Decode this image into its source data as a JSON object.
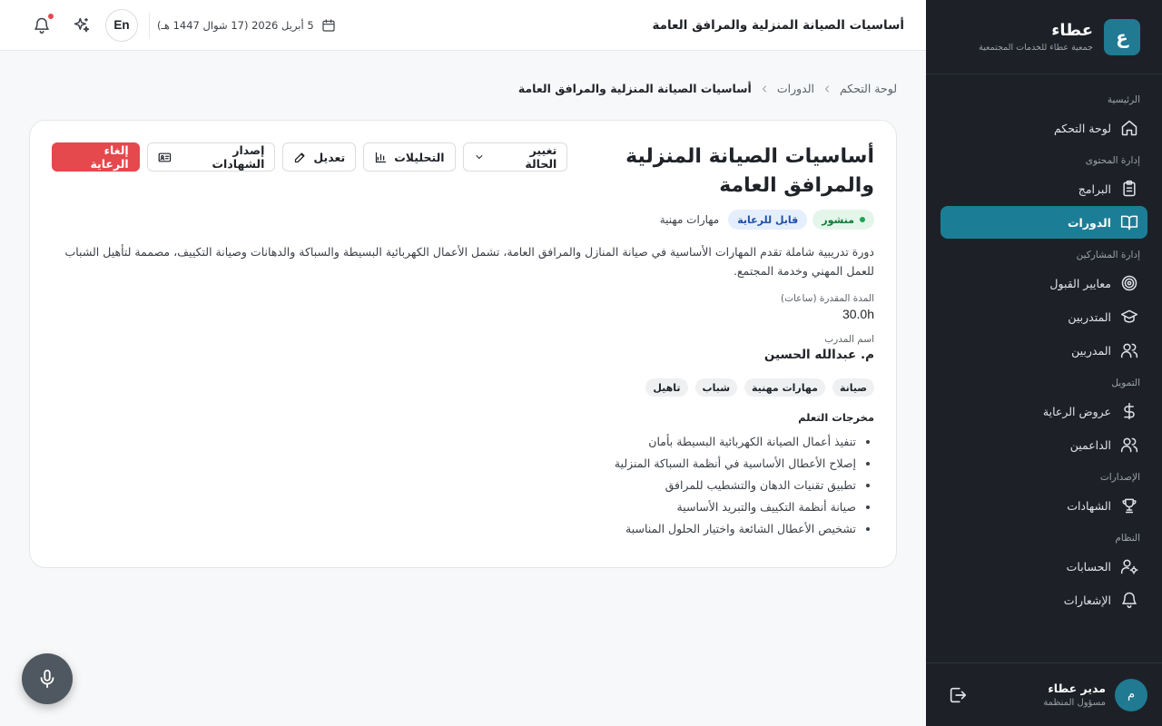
{
  "brand": {
    "logo_letter": "ع",
    "name": "عطاء",
    "subtitle": "جمعية عطاء للخدمات المجتمعية"
  },
  "sidebar": {
    "sections": [
      {
        "label": "الرئيسية",
        "items": [
          {
            "label": "لوحة التحكم",
            "icon": "home-icon"
          }
        ]
      },
      {
        "label": "إدارة المحتوى",
        "items": [
          {
            "label": "البرامج",
            "icon": "clipboard-icon"
          },
          {
            "label": "الدورات",
            "icon": "book-open-icon",
            "active": true
          }
        ]
      },
      {
        "label": "إدارة المشاركين",
        "items": [
          {
            "label": "معايير القبول",
            "icon": "target-icon"
          },
          {
            "label": "المتدربين",
            "icon": "graduation-cap-icon"
          },
          {
            "label": "المدربين",
            "icon": "users-icon"
          }
        ]
      },
      {
        "label": "التمويل",
        "items": [
          {
            "label": "عروض الرعاية",
            "icon": "dollar-icon"
          },
          {
            "label": "الداعمين",
            "icon": "users-icon"
          }
        ]
      },
      {
        "label": "الإصدارات",
        "items": [
          {
            "label": "الشهادات",
            "icon": "trophy-icon"
          }
        ]
      },
      {
        "label": "النظام",
        "items": [
          {
            "label": "الحسابات",
            "icon": "user-cog-icon"
          },
          {
            "label": "الإشعارات",
            "icon": "bell-icon"
          }
        ]
      }
    ]
  },
  "user": {
    "initial": "م",
    "name": "مدير عطاء",
    "role": "مسؤول المنظمة"
  },
  "topbar": {
    "title": "أساسيات الصيانة المنزلية والمرافق العامة",
    "date": "5 أبريل 2026 (17 شوال 1447 هـ)",
    "lang": "En"
  },
  "breadcrumb": {
    "home": "لوحة التحكم",
    "section": "الدورات",
    "current": "أساسيات الصيانة المنزلية والمرافق العامة"
  },
  "course": {
    "title": "أساسيات الصيانة المنزلية والمرافق العامة",
    "status": "منشور",
    "sponsor_badge": "قابل للرعاية",
    "category": "مهارات مهنية",
    "description": "دورة تدريبية شاملة تقدم المهارات الأساسية في صيانة المنازل والمرافق العامة، تشمل الأعمال الكهربائية البسيطة والسباكة والدهانات وصيانة التكييف، مصممة لتأهيل الشباب للعمل المهني وخدمة المجتمع.",
    "duration_label": "المدة المقدرة (ساعات)",
    "duration_value": "30.0h",
    "instructor_label": "اسم المدرب",
    "instructor_value": "م. عبدالله الحسين",
    "tags": [
      "صيانة",
      "مهارات مهنية",
      "شباب",
      "تاهيل"
    ],
    "outcomes_title": "مخرجات التعلم",
    "outcomes": [
      "تنفيذ أعمال الصيانة الكهربائية البسيطة بأمان",
      "إصلاح الأعطال الأساسية في أنظمة السباكة المنزلية",
      "تطبيق تقنيات الدهان والتشطيب للمرافق",
      "صيانة أنظمة التكييف والتبريد الأساسية",
      "تشخيص الأعطال الشائعة واختيار الحلول المناسبة"
    ]
  },
  "actions": {
    "change_status": "تغيير الحالة",
    "analytics": "التحليلات",
    "edit": "تعديل",
    "issue_certificates": "إصدار الشهادات",
    "cancel_sponsorship": "إلغاء الرعاية"
  },
  "colors": {
    "sidebar_bg": "#1d2127",
    "accent": "#1c7e96",
    "danger": "#e5484d",
    "published_bg": "#e4f6ea",
    "sponsor_bg": "#e5eefc"
  }
}
